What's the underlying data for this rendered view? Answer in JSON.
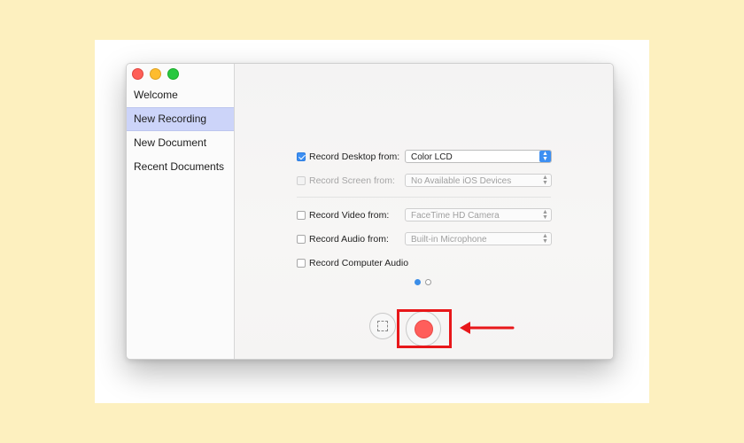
{
  "window": {
    "sidebar": {
      "items": [
        {
          "label": "Welcome",
          "selected": false
        },
        {
          "label": "New Recording",
          "selected": true
        },
        {
          "label": "New Document",
          "selected": false
        },
        {
          "label": "Recent Documents",
          "selected": false
        }
      ]
    },
    "options": {
      "record_desktop": {
        "label": "Record Desktop from:",
        "checked": true,
        "value": "Color LCD"
      },
      "record_screen": {
        "label": "Record Screen from:",
        "checked": false,
        "enabled": false,
        "value": "No Available iOS Devices"
      },
      "record_video": {
        "label": "Record Video from:",
        "checked": false,
        "value": "FaceTime HD Camera"
      },
      "record_audio": {
        "label": "Record Audio from:",
        "checked": false,
        "value": "Built-in Microphone"
      },
      "record_computer_audio": {
        "label": "Record Computer Audio",
        "checked": false
      }
    },
    "pager": {
      "pages": 2,
      "current": 1
    }
  },
  "colors": {
    "background": "#fdf0bf",
    "accent": "#3d8ff2",
    "record": "#ff5e5b",
    "highlight": "#e8171a",
    "selection": "#ccd4f9"
  }
}
